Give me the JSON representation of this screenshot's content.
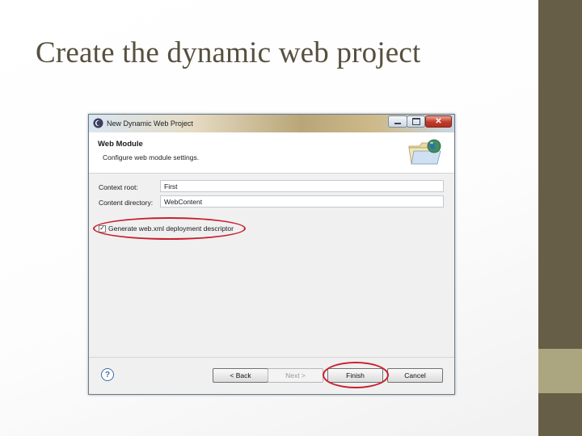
{
  "slide": {
    "title": "Create the dynamic web project"
  },
  "dialog": {
    "window_title": "New Dynamic Web Project",
    "header": {
      "title": "Web Module",
      "subtitle": "Configure web module settings.",
      "icon": "folder-globe-icon"
    },
    "fields": {
      "context_root": {
        "label": "Context root:",
        "value": "First"
      },
      "content_directory": {
        "label": "Content directory:",
        "value": "WebContent"
      }
    },
    "checkbox": {
      "label": "Generate web.xml deployment descriptor",
      "checked": true,
      "mark": "✓"
    },
    "buttons": {
      "back": "< Back",
      "next": "Next >",
      "finish": "Finish",
      "cancel": "Cancel",
      "help": "?"
    },
    "window_controls": {
      "close": "✕"
    }
  },
  "colors": {
    "highlight": "#c8202e",
    "sidebar": "#675e47",
    "sidebar_accent": "#aba67f",
    "title_text": "#56503f"
  }
}
